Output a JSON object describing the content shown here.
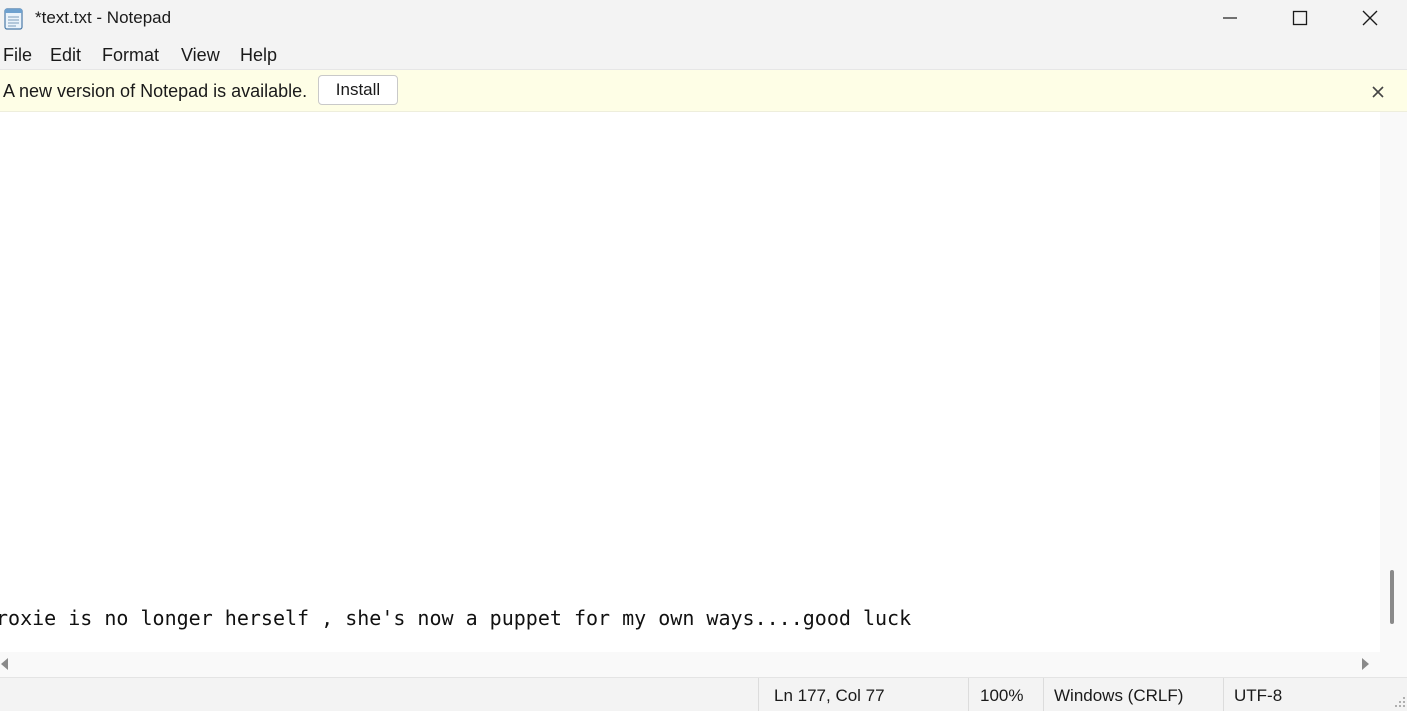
{
  "window": {
    "title": "*text.txt - Notepad",
    "app_icon": "notepad-icon",
    "controls": [
      "minimize-icon",
      "maximize-icon",
      "close-icon"
    ]
  },
  "menu": {
    "file": "File",
    "edit": "Edit",
    "format": "Format",
    "view": "View",
    "help": "Help"
  },
  "infobar": {
    "message": "A new version of Notepad is available.",
    "install_label": "Install",
    "background_color": "#fefee6"
  },
  "editor": {
    "visible_line": "roxie is no longer herself , she's now a puppet for my own ways....good luck"
  },
  "status": {
    "position": "Ln 177, Col 77",
    "zoom": "100%",
    "line_endings": "Windows (CRLF)",
    "encoding": "UTF-8"
  }
}
